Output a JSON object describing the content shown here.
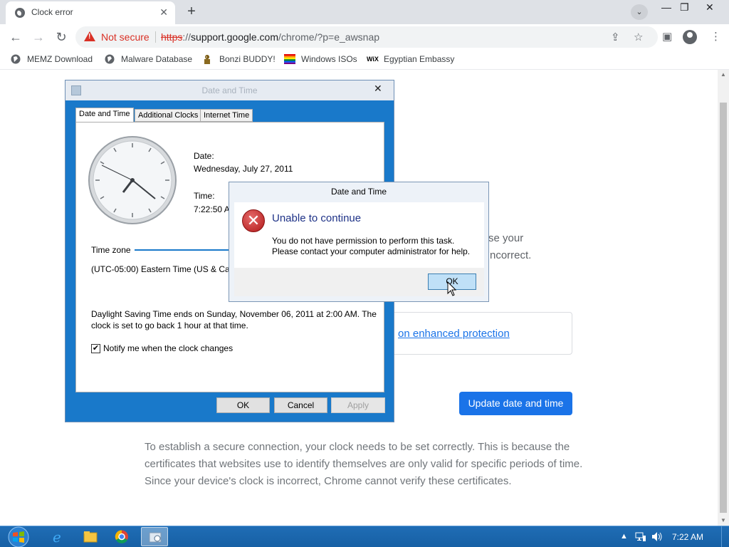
{
  "browser": {
    "tab_title": "Clock error",
    "new_tab_label": "+",
    "tab_search_icon": "chevron-down-icon",
    "window_controls": {
      "minimize": "—",
      "restore": "❐",
      "close": "✕"
    },
    "nav": {
      "back": "←",
      "forward": "→",
      "reload": "↻"
    },
    "security_label": "Not secure",
    "url": {
      "scheme": "https",
      "rest_prefix": "://",
      "host": "support.google.com",
      "path": "/chrome/?p=e_awsnap"
    },
    "bookmarks": [
      {
        "label": "MEMZ Download",
        "icon": "globe-icon"
      },
      {
        "label": "Malware Database",
        "icon": "globe-icon"
      },
      {
        "label": "Bonzi BUDDY!",
        "icon": "bonzi-icon"
      },
      {
        "label": "Windows ISOs",
        "icon": "windows-flag-icon"
      },
      {
        "label": "Egyptian Embassy",
        "icon": "wix-icon",
        "icon_text": "WiX"
      }
    ]
  },
  "page": {
    "partial_text_1": "se your",
    "partial_text_2": "ncorrect.",
    "protection_link": "on enhanced protection",
    "update_button": "Update date and time",
    "explanation": "To establish a secure connection, your clock needs to be set correctly. This is because the certificates that websites use to identify themselves are only valid for specific periods of time. Since your device's clock is incorrect, Chrome cannot verify these certificates."
  },
  "datetime_dialog": {
    "title": "Date and Time",
    "tabs": [
      "Date and Time",
      "Additional Clocks",
      "Internet Time"
    ],
    "date_label": "Date:",
    "date_value": "Wednesday, July 27, 2011",
    "time_label": "Time:",
    "time_value": "7:22:50 AM",
    "timezone_label": "Time zone",
    "timezone_value": "(UTC-05:00) Eastern Time (US & Cana",
    "dst_line1": "Daylight Saving Time ends on Sunday, November 06, 2011 at 2:00 AM. The",
    "dst_line2": "clock is set to go back 1 hour at that time.",
    "notify_label": "Notify me when the clock changes",
    "notify_checked": "✔",
    "ok": "OK",
    "cancel": "Cancel",
    "apply": "Apply"
  },
  "error_dialog": {
    "title": "Date and Time",
    "heading": "Unable to continue",
    "message_line1": "You do not have permission to perform this task.",
    "message_line2": "Please contact your computer administrator for help.",
    "ok": "OK",
    "icon_glyph": "✕"
  },
  "taskbar": {
    "time": "7:22 AM",
    "tray_arrow": "▲",
    "colors": {
      "bar": "#1f6db5",
      "accent": "#1a73e8",
      "error": "#d93025"
    }
  }
}
